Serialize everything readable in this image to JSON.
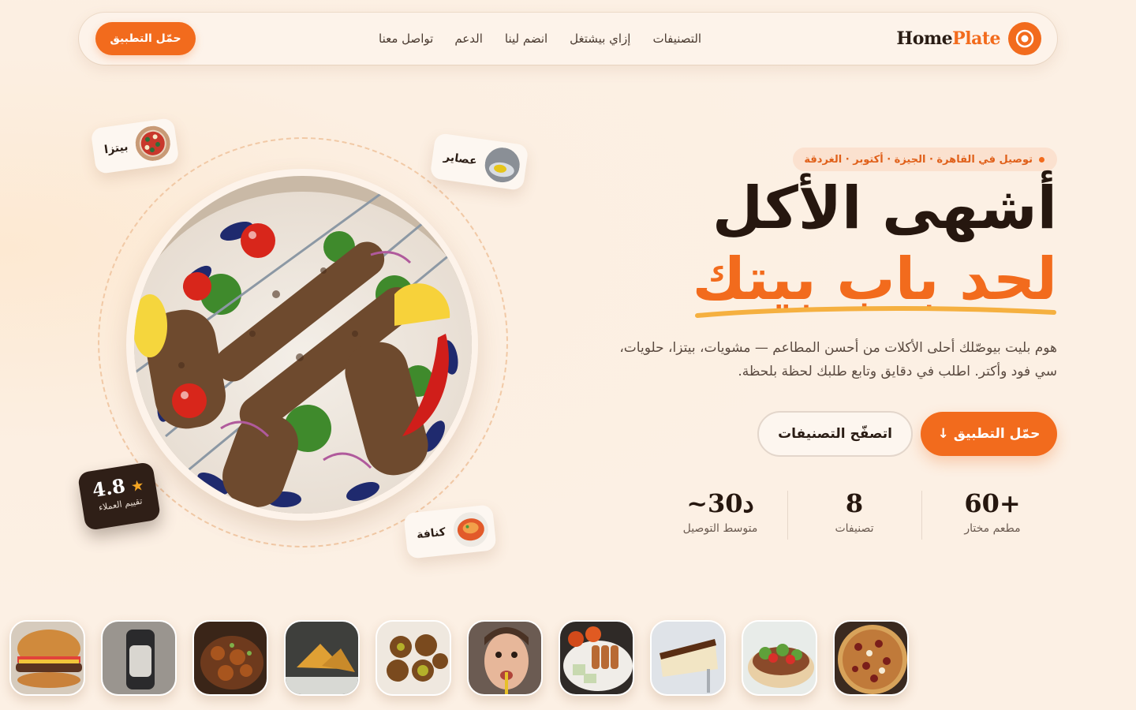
{
  "nav": {
    "cta_label": "حمّل التطبيق",
    "links": [
      "التصنيفات",
      "إزاي بيشتغل",
      "انضم لينا",
      "الدعم",
      "تواصل معنا"
    ],
    "brand_part1": "Home",
    "brand_part2": "Plate"
  },
  "hero": {
    "pill": "توصيل في القاهرة · الجيزة · أكتوبر · الغردقة",
    "title_line1": "أشهى الأكل",
    "title_line2": "لحد باب بيتك",
    "description": "هوم بليت بيوصّلك أحلى الأكلات من أحسن المطاعم — مشويات، بيتزا، حلويات، سي فود وأكتر. اطلب في دقايق وتابع طلبك لحظة بلحظة.",
    "primary_button": "حمّل التطبيق ↓",
    "secondary_button": "اتصفّح التصنيفات",
    "stats": [
      {
        "value": "60+",
        "label": "مطعم مختار"
      },
      {
        "value": "8",
        "label": "تصنيفات"
      },
      {
        "value": "~30د",
        "label": "متوسط التوصيل"
      }
    ]
  },
  "floating": {
    "chips": [
      "بيتزا",
      "عصاير",
      "كنافة"
    ],
    "rating_value": "4.8",
    "rating_label": "تقييم العملاء"
  },
  "colors": {
    "accent": "#f26b1d",
    "dark": "#26170f",
    "background": "#fcf0e4"
  },
  "strip_tiles": [
    "burger",
    "blender",
    "noodles",
    "samosa",
    "falafel",
    "person-drinking",
    "skewers",
    "cheesecake",
    "sandwich",
    "pizza"
  ]
}
